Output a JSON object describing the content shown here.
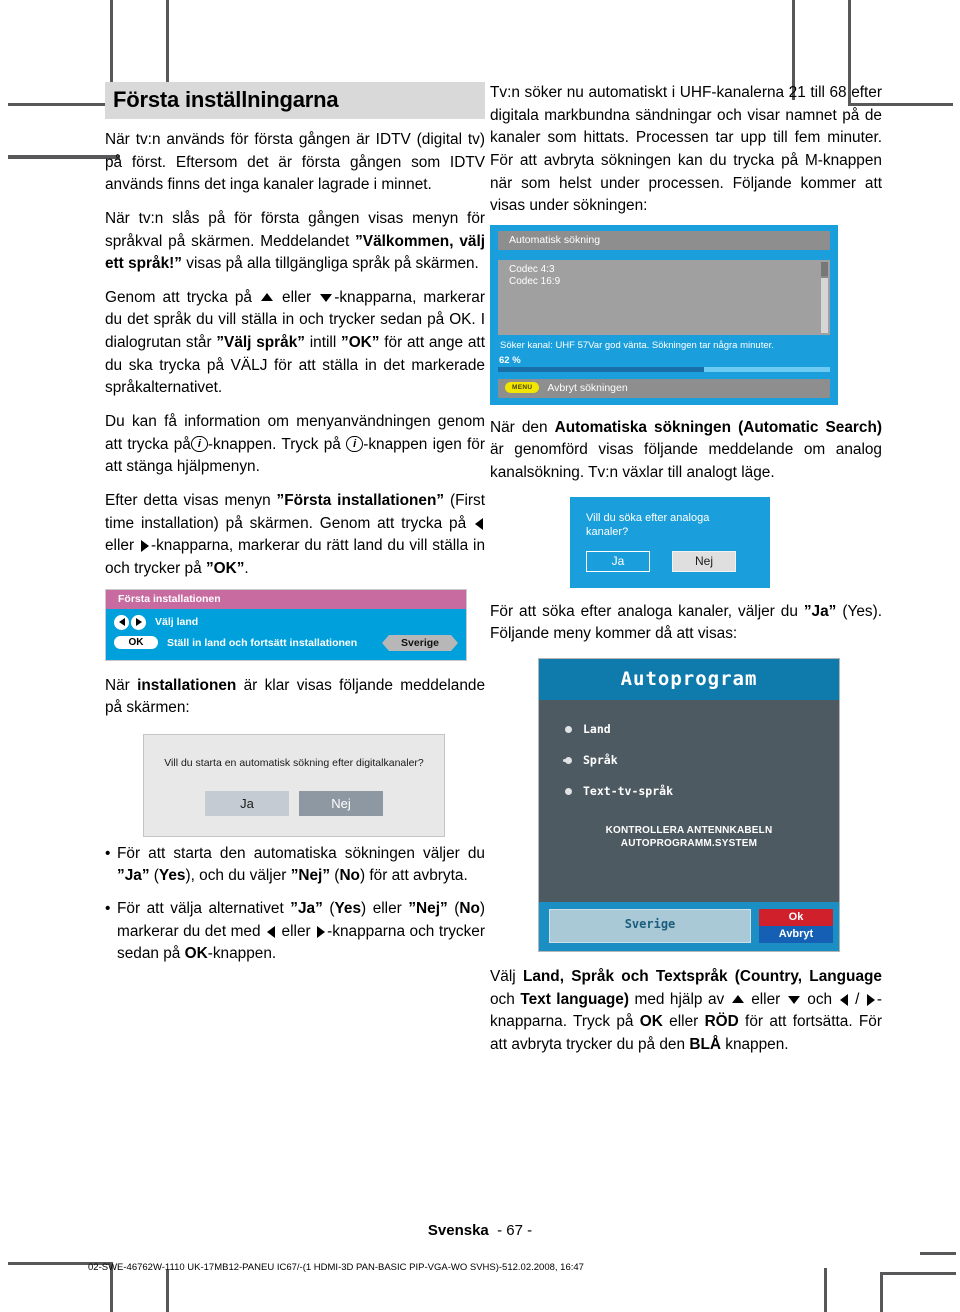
{
  "document": {
    "page_label": "Svenska",
    "page_number": "- 67 -",
    "doc_code": "02-SWE-46762W-1110 UK-17MB12-PANEU IC67/-(1 HDMI-3D PAN-BASIC PIP-VGA-WO SVHS)-512.02.2008, 16:47"
  },
  "left_column": {
    "section_title": "Första inställningarna",
    "para1_a": "När tv:n används för första gången är IDTV (digital tv) på först. Eftersom det är första gången som IDTV används finns det inga kanaler lagrade i minnet.",
    "para2_a": "När tv:n slås på för första gången visas menyn för språkval på skärmen. Meddelandet ",
    "para2_bold": "”Välkommen, välj ett språk!”",
    "para2_b": " visas på alla tillgängliga språk på skärmen.",
    "para3_a": "Genom att trycka på ",
    "para3_b": " eller ",
    "para3_c": "-knapparna, markerar du det språk du vill ställa in och trycker sedan på OK. I dialogrutan står ",
    "para3_bold1": "”Välj språk”",
    "para3_d": " intill ",
    "para3_bold2": "”OK”",
    "para3_e": " för att ange att du ska trycka på VÄLJ för att ställa in det markerade språkalternativet.",
    "para4_a": "Du kan få information om menyanvändningen genom att trycka på",
    "para4_b": "-knappen. Tryck på ",
    "para4_c": "-knappen igen för att stänga hjälpmenyn.",
    "para5_a": "Efter detta visas menyn ",
    "para5_bold1": "”Första installationen”",
    "para5_b": " (First time installation) på skärmen. Genom att trycka på ",
    "para5_c": " eller ",
    "para5_d": "-knapparna, markerar du rätt land du vill ställa in och trycker på ",
    "para5_bold2": "”OK”",
    "para5_e": ".",
    "para6_a": "När ",
    "para6_bold": "installationen",
    "para6_b": " är klar visas följande meddelande på skärmen:",
    "bullet1_a": "För att starta den automatiska sökningen väljer du ",
    "bullet1_bold1": "”Ja”",
    "bullet1_b": " (",
    "bullet1_bold2": "Yes",
    "bullet1_c": "), och du väljer ",
    "bullet1_bold3": "”Nej”",
    "bullet1_d": " (",
    "bullet1_bold4": "No",
    "bullet1_e": ") för att avbryta.",
    "bullet2_a": "För att välja alternativet ",
    "bullet2_bold1": "”Ja”",
    "bullet2_b": " (",
    "bullet2_bold2": "Yes",
    "bullet2_c": ") eller ",
    "bullet2_bold3": "”Nej”",
    "bullet2_d": " (",
    "bullet2_bold4": "No",
    "bullet2_e": ") markerar du det med ",
    "bullet2_f": " eller ",
    "bullet2_g": "-knapparna och trycker sedan på ",
    "bullet2_bold5": "OK",
    "bullet2_h": "-knappen."
  },
  "osd_first_install": {
    "header": "Första installationen",
    "row1_label": "Välj land",
    "ok_label": "OK",
    "row2_label": "Ställ in land och fortsätt installationen",
    "country_value": "Sverige"
  },
  "dialog_digital_search": {
    "message": "Vill du starta en automatisk sökning efter digitalkanaler?",
    "yes_label": "Ja",
    "no_label": "Nej"
  },
  "right_column": {
    "para1": "Tv:n söker nu automatiskt i UHF-kanalerna 21 till 68 efter digitala markbundna sändningar och visar namnet på de kanaler som hittats. Processen tar upp till fem minuter. För att avbryta sökningen kan du trycka på M-knappen när som helst under processen. Följande kommer att visas under sökningen:",
    "para2_a": "När den ",
    "para2_bold": "Automatiska sökningen (Automatic Search)",
    "para2_b": " är genomförd visas följande meddelande om analog kanalsökning. Tv:n växlar till analogt läge.",
    "para3_a": "För att söka efter analoga kanaler, väljer du ",
    "para3_bold": "”Ja”",
    "para3_b": " (Yes). Följande meny kommer då att visas:",
    "para4_a": "Välj ",
    "para4_bold1": "Land, Språk och Textspråk (Country, Language",
    "para4_b": " och ",
    "para4_bold2": "Text language)",
    "para4_c": " med  hjälp av ",
    "para4_d": " eller ",
    "para4_e": " och ",
    "para4_f": " / ",
    "para4_g": "-knapparna. Tryck på ",
    "para4_bold3": "OK",
    "para4_h": " eller ",
    "para4_bold4": "RÖD",
    "para4_i": " för att fortsätta. För att avbryta trycker du på den ",
    "para4_bold5": "BLÅ",
    "para4_j": " knappen."
  },
  "osd_auto_search": {
    "header": "Automatisk sökning",
    "channels": [
      "Codec 4:3",
      "Codec 16:9"
    ],
    "status": "Söker kanal: UHF 57Var god vänta. Sökningen tar några minuter.",
    "progress_label": "62 %",
    "progress_percent": 62,
    "menu_key": "MENU",
    "cancel_label": "Avbryt sökningen"
  },
  "dialog_analog_search": {
    "message": "Vill du söka efter analoga kanaler?",
    "yes_label": "Ja",
    "no_label": "Nej"
  },
  "osd_autoprogram": {
    "title": "Autoprogram",
    "items": [
      "Land",
      "Språk",
      "Text-tv-språk"
    ],
    "notice_line1": "KONTROLLERA  ANTENNKABELN",
    "notice_line2": "AUTOPROGRAMM.SYSTEM",
    "country_value": "Sverige",
    "ok_label": "Ok",
    "cancel_label": "Avbryt"
  },
  "colors": {
    "section_title_bg": "#d9d9d9",
    "osd_blue": "#1b9fdc",
    "osd_pink_header": "#c76ba0",
    "autoprogram_title": "#0f7bad",
    "autoprogram_body": "#4e5a61",
    "ok_red": "#d0202b",
    "cancel_blue": "#1560b5",
    "menu_yellow": "#f2e600"
  }
}
